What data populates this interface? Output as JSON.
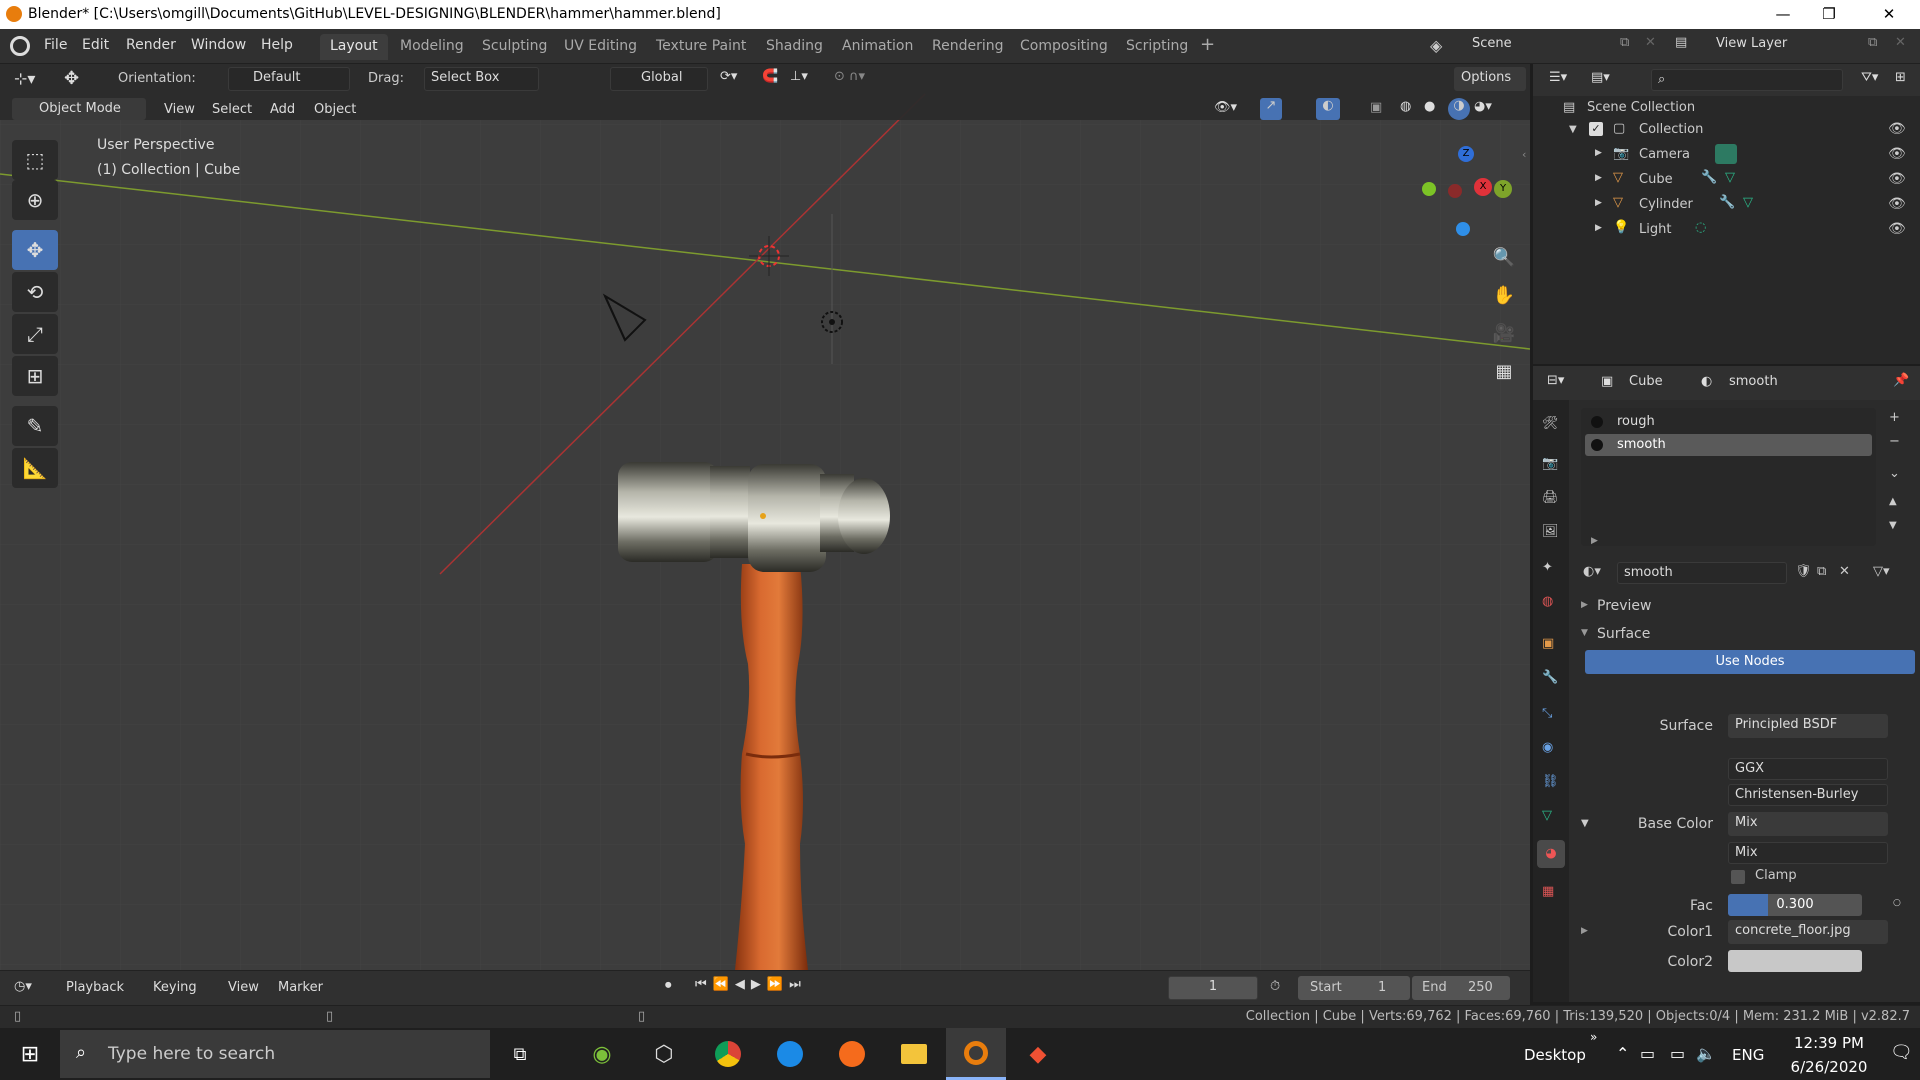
{
  "window": {
    "title": "Blender* [C:\\Users\\omgill\\Documents\\GitHub\\LEVEL-DESIGNING\\BLENDER\\hammer\\hammer.blend]",
    "min": "—",
    "max": "❐",
    "close": "✕"
  },
  "menus": [
    "File",
    "Edit",
    "Render",
    "Window",
    "Help"
  ],
  "workspaces": [
    "Layout",
    "Modeling",
    "Sculpting",
    "UV Editing",
    "Texture Paint",
    "Shading",
    "Animation",
    "Rendering",
    "Compositing",
    "Scripting"
  ],
  "scene_label": "Scene",
  "view_layer_label": "View Layer",
  "toolheader": {
    "orientation_label": "Orientation:",
    "orientation_value": "Default",
    "drag_label": "Drag:",
    "drag_value": "Select Box",
    "transform_value": "Global",
    "options": "Options"
  },
  "viewheader": {
    "mode": "Object Mode",
    "view": "View",
    "select": "Select",
    "add": "Add",
    "object": "Object"
  },
  "overlay": {
    "line1": "User Perspective",
    "line2": "(1) Collection | Cube"
  },
  "gizmo": {
    "z": "Z",
    "x": "X",
    "y": "Y"
  },
  "outliner": {
    "root": "Scene Collection",
    "collection": "Collection",
    "items": [
      "Camera",
      "Cube",
      "Cylinder",
      "Light"
    ]
  },
  "props": {
    "object": "Cube",
    "material": "smooth",
    "slots": [
      "rough",
      "smooth"
    ],
    "material_field": "smooth",
    "preview": "Preview",
    "surface_section": "Surface",
    "use_nodes": "Use Nodes",
    "rows": {
      "surface_label": "Surface",
      "surface_value": "Principled BSDF",
      "dist1": "GGX",
      "dist2": "Christensen-Burley",
      "base_color_label": "Base Color",
      "base_color_value": "Mix",
      "mix_value": "Mix",
      "clamp": "Clamp",
      "fac_label": "Fac",
      "fac_value": "0.300",
      "color1_label": "Color1",
      "color1_value": "concrete_floor.jpg",
      "color2_label": "Color2"
    }
  },
  "fac_fraction": 0.3,
  "timeline": {
    "playback": "Playback",
    "keying": "Keying",
    "view": "View",
    "marker": "Marker",
    "frame": "1",
    "start_label": "Start",
    "start": "1",
    "end_label": "End",
    "end": "250"
  },
  "status": "Collection | Cube | Verts:69,762 | Faces:69,760 | Tris:139,520 | Objects:0/4 | Mem: 231.2 MiB | v2.82.7",
  "taskbar": {
    "search_placeholder": "Type here to search",
    "desktop": "Desktop",
    "lang": "ENG",
    "time": "12:39 PM",
    "date": "6/26/2020"
  },
  "colors": {
    "accent": "#4772b3",
    "handle": "#c8612a",
    "metal": "#8a8a7e"
  }
}
